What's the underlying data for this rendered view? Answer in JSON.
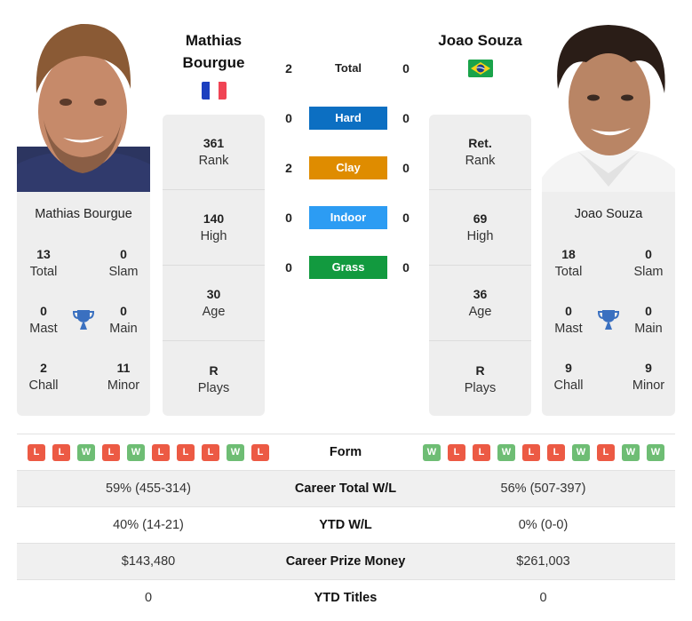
{
  "colors": {
    "hard": "#0c6fc2",
    "clay": "#df8c00",
    "indoor": "#2c9cf3",
    "grass": "#129a3f",
    "win": "#6ebd74",
    "loss": "#ec5a44",
    "trophy": "#3a70c0"
  },
  "player1": {
    "name_line1": "Mathias",
    "name_line2": "Bourgue",
    "full_name": "Mathias Bourgue",
    "flag": "france-flag",
    "rank": {
      "value": "361",
      "label": "Rank"
    },
    "high": {
      "value": "140",
      "label": "High"
    },
    "age": {
      "value": "30",
      "label": "Age"
    },
    "plays": {
      "value": "R",
      "label": "Plays"
    },
    "titles": {
      "total": {
        "value": "13",
        "label": "Total"
      },
      "slam": {
        "value": "0",
        "label": "Slam"
      },
      "mast": {
        "value": "0",
        "label": "Mast"
      },
      "main": {
        "value": "0",
        "label": "Main"
      },
      "chall": {
        "value": "2",
        "label": "Chall"
      },
      "minor": {
        "value": "11",
        "label": "Minor"
      }
    },
    "form": [
      "L",
      "L",
      "W",
      "L",
      "W",
      "L",
      "L",
      "L",
      "W",
      "L"
    ]
  },
  "player2": {
    "name": "Joao Souza",
    "full_name": "Joao Souza",
    "flag": "brazil-flag",
    "rank": {
      "value": "Ret.",
      "label": "Rank"
    },
    "high": {
      "value": "69",
      "label": "High"
    },
    "age": {
      "value": "36",
      "label": "Age"
    },
    "plays": {
      "value": "R",
      "label": "Plays"
    },
    "titles": {
      "total": {
        "value": "18",
        "label": "Total"
      },
      "slam": {
        "value": "0",
        "label": "Slam"
      },
      "mast": {
        "value": "0",
        "label": "Mast"
      },
      "main": {
        "value": "0",
        "label": "Main"
      },
      "chall": {
        "value": "9",
        "label": "Chall"
      },
      "minor": {
        "value": "9",
        "label": "Minor"
      }
    },
    "form": [
      "W",
      "L",
      "L",
      "W",
      "L",
      "L",
      "W",
      "L",
      "W",
      "W"
    ]
  },
  "h2h": [
    {
      "label": "Total",
      "left": "2",
      "right": "0",
      "surface": "total"
    },
    {
      "label": "Hard",
      "left": "0",
      "right": "0",
      "surface": "hard"
    },
    {
      "label": "Clay",
      "left": "2",
      "right": "0",
      "surface": "clay"
    },
    {
      "label": "Indoor",
      "left": "0",
      "right": "0",
      "surface": "indoor"
    },
    {
      "label": "Grass",
      "left": "0",
      "right": "0",
      "surface": "grass"
    }
  ],
  "table": {
    "form_label": "Form",
    "rows": [
      {
        "label": "Career Total W/L",
        "left": "59% (455-314)",
        "right": "56% (507-397)"
      },
      {
        "label": "YTD W/L",
        "left": "40% (14-21)",
        "right": "0% (0-0)"
      },
      {
        "label": "Career Prize Money",
        "left": "$143,480",
        "right": "$261,003"
      },
      {
        "label": "YTD Titles",
        "left": "0",
        "right": "0"
      }
    ]
  }
}
